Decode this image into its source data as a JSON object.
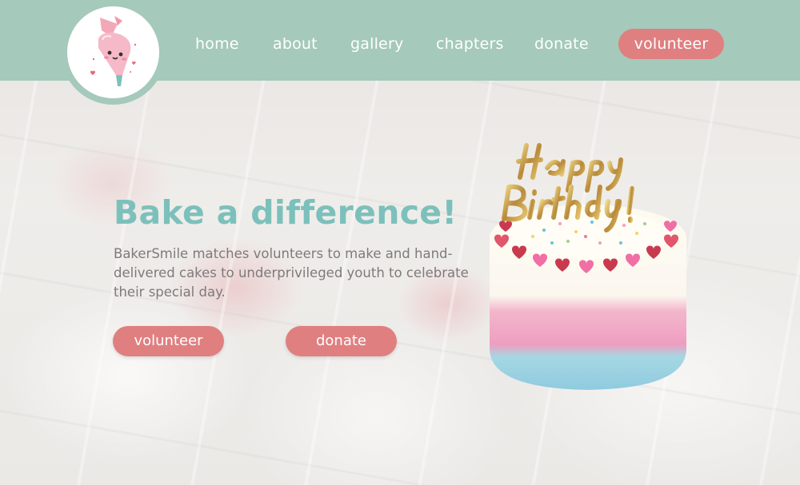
{
  "header": {
    "logo_icon": "piping-bag-mascot-icon",
    "nav": [
      {
        "label": "home"
      },
      {
        "label": "about"
      },
      {
        "label": "gallery"
      },
      {
        "label": "chapters"
      },
      {
        "label": "donate"
      },
      {
        "label": "volunteer"
      }
    ]
  },
  "hero": {
    "title": "Bake a difference!",
    "description": "BakerSmile matches volunteers to make and hand-delivered cakes to underprivileged youth to celebrate their special day.",
    "buttons": {
      "volunteer": "volunteer",
      "donate": "donate"
    },
    "image_icon": "birthday-cake-image"
  },
  "colors": {
    "header_bg": "#a5c9bb",
    "accent_button": "#e07f80",
    "title": "#7cc0bb",
    "body_text": "#7e7a7a"
  }
}
